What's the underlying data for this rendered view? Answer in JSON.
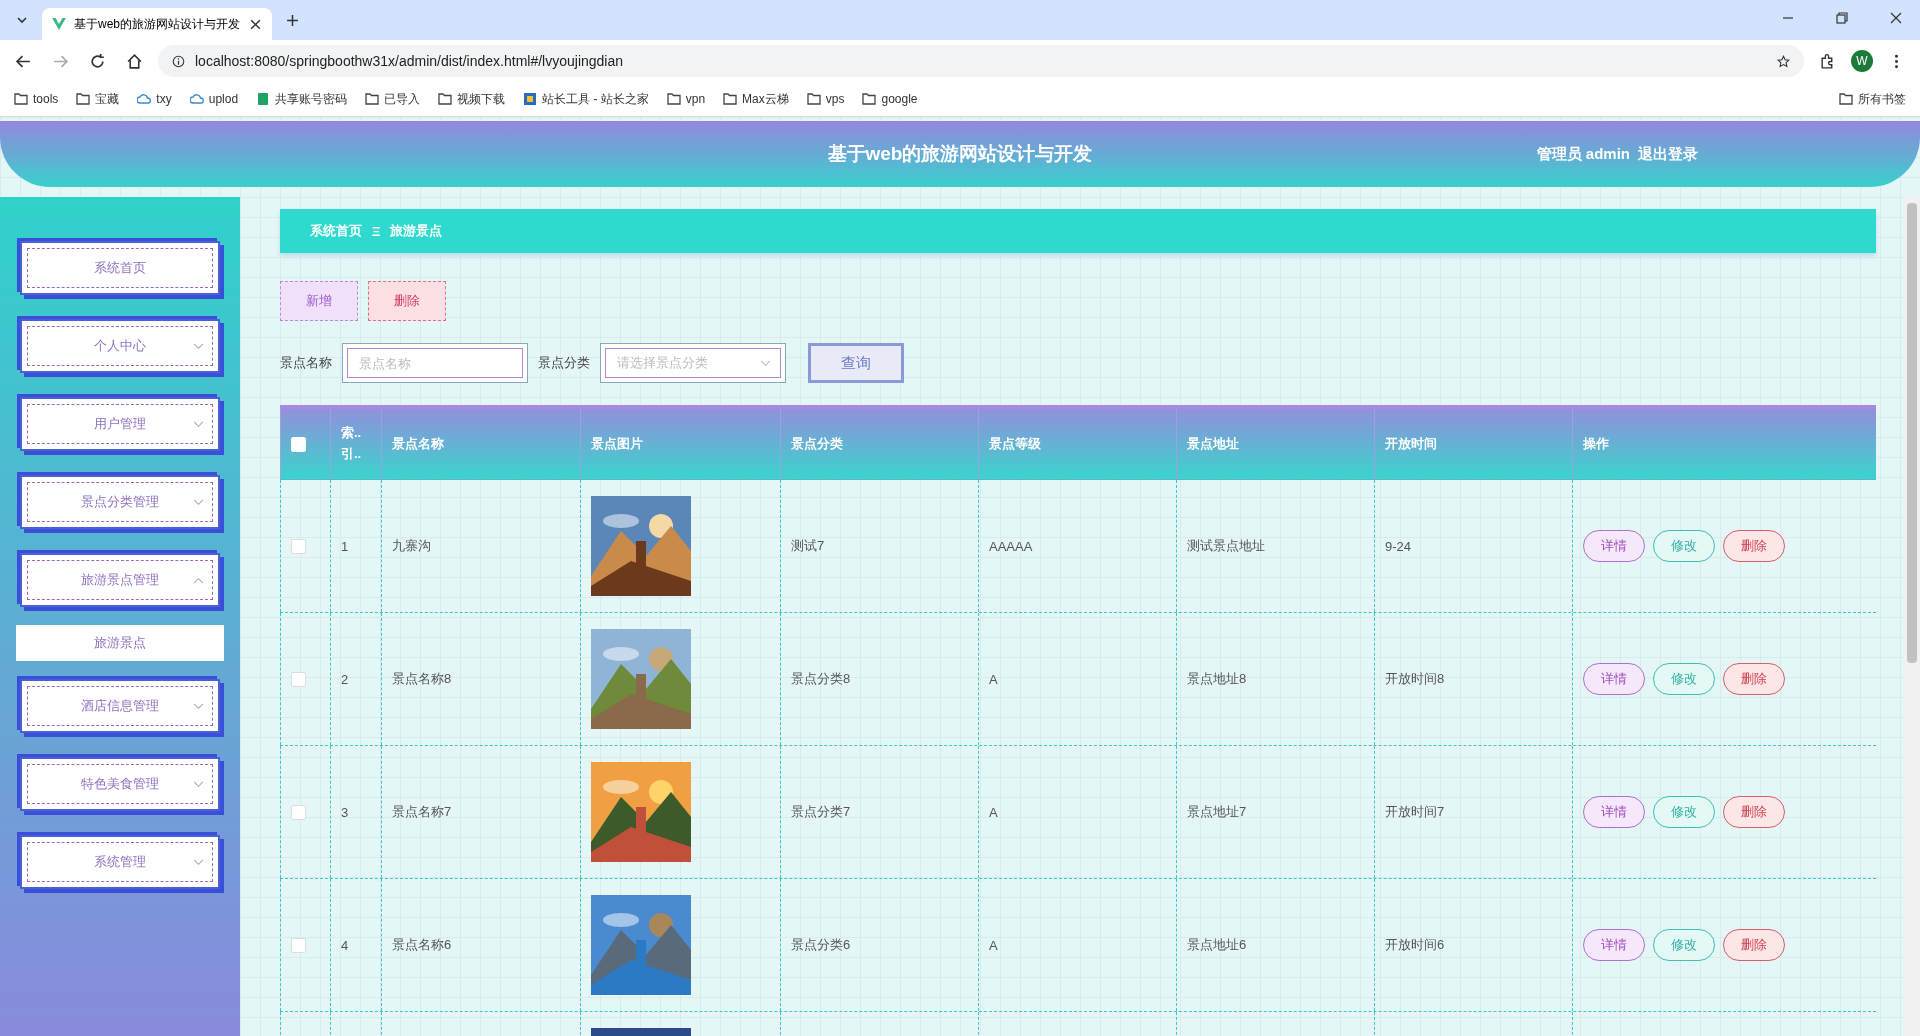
{
  "browser": {
    "tab_title": "基于web的旅游网站设计与开发",
    "url": "localhost:8080/springboothw31x/admin/dist/index.html#/lvyoujingdian",
    "profile": "W",
    "bookmarks": [
      {
        "label": "tools",
        "kind": "folder"
      },
      {
        "label": "宝藏",
        "kind": "folder"
      },
      {
        "label": "txy",
        "kind": "cloud"
      },
      {
        "label": "uplod",
        "kind": "cloud"
      },
      {
        "label": "共享账号密码",
        "kind": "sheet"
      },
      {
        "label": "已导入",
        "kind": "folder"
      },
      {
        "label": "视频下载",
        "kind": "folder"
      },
      {
        "label": "站长工具 - 站长之家",
        "kind": "site"
      },
      {
        "label": "vpn",
        "kind": "folder"
      },
      {
        "label": "Max云梯",
        "kind": "folder"
      },
      {
        "label": "vps",
        "kind": "folder"
      },
      {
        "label": "google",
        "kind": "folder"
      }
    ],
    "all_bookmarks": "所有书签"
  },
  "header": {
    "title": "基于web的旅游网站设计与开发",
    "user": "管理员 admin",
    "logout": "退出登录"
  },
  "sidebar": [
    {
      "label": "系统首页",
      "kind": "link"
    },
    {
      "label": "个人中心",
      "kind": "menu",
      "expanded": false
    },
    {
      "label": "用户管理",
      "kind": "menu",
      "expanded": false
    },
    {
      "label": "景点分类管理",
      "kind": "menu",
      "expanded": false
    },
    {
      "label": "旅游景点管理",
      "kind": "menu",
      "expanded": true,
      "children": [
        {
          "label": "旅游景点",
          "selected": true
        }
      ]
    },
    {
      "label": "酒店信息管理",
      "kind": "menu",
      "expanded": false
    },
    {
      "label": "特色美食管理",
      "kind": "menu",
      "expanded": false
    },
    {
      "label": "系统管理",
      "kind": "menu",
      "expanded": false
    }
  ],
  "breadcrumb": [
    "系统首页",
    "旅游景点"
  ],
  "breadcrumb_separator": "Ξ",
  "actions": [
    {
      "label": "新增",
      "kind": "add"
    },
    {
      "label": "删除",
      "kind": "delete"
    }
  ],
  "search": {
    "name_label": "景点名称",
    "name_placeholder": "景点名称",
    "category_label": "景点分类",
    "category_placeholder": "请选择景点分类",
    "button": "查询"
  },
  "table": {
    "select_all_checked": false,
    "columns": [
      "索..引..",
      "景点名称",
      "景点图片",
      "景点分类",
      "景点等级",
      "景点地址",
      "开放时间",
      "操作"
    ],
    "rows": [
      {
        "checked": false,
        "index": "1",
        "name": "九寨沟",
        "picture": {
          "kind": "picture"
        },
        "category": "测试7",
        "grade": "AAAAA",
        "address": "测试景点地址",
        "hours": "9-24",
        "buttons": [
          "详情",
          "修改",
          "删除"
        ]
      },
      {
        "checked": false,
        "index": "2",
        "name": "景点名称8",
        "picture": {
          "kind": "picture"
        },
        "category": "景点分类8",
        "grade": "A",
        "address": "景点地址8",
        "hours": "开放时间8",
        "buttons": [
          "详情",
          "修改",
          "删除"
        ]
      },
      {
        "checked": false,
        "index": "3",
        "name": "景点名称7",
        "picture": {
          "kind": "picture"
        },
        "category": "景点分类7",
        "grade": "A",
        "address": "景点地址7",
        "hours": "开放时间7",
        "buttons": [
          "详情",
          "修改",
          "删除"
        ]
      },
      {
        "checked": false,
        "index": "4",
        "name": "景点名称6",
        "picture": {
          "kind": "picture"
        },
        "category": "景点分类6",
        "grade": "A",
        "address": "景点地址6",
        "hours": "开放时间6",
        "buttons": [
          "详情",
          "修改",
          "删除"
        ]
      },
      {
        "picture": {
          "kind": "picture"
        }
      }
    ]
  }
}
